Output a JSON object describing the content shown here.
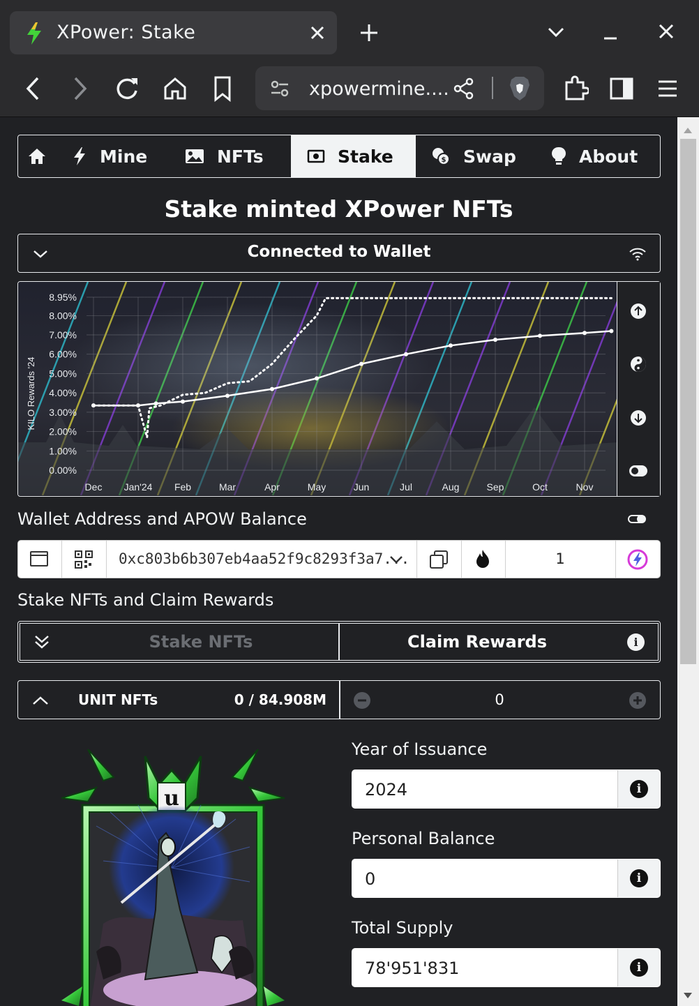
{
  "browser": {
    "tab_title": "XPower: Stake",
    "url": "xpowermine...."
  },
  "nav": {
    "items": [
      {
        "label": "Mine"
      },
      {
        "label": "NFTs"
      },
      {
        "label": "Stake"
      },
      {
        "label": "Swap"
      },
      {
        "label": "About"
      }
    ],
    "active": "Stake"
  },
  "page": {
    "title": "Stake minted XPower NFTs"
  },
  "wallet_bar": {
    "label": "Connected to Wallet"
  },
  "chart_data": {
    "type": "line",
    "ylabel": "KILO Rewards '24",
    "x_ticks": [
      "Dec",
      "Jan'24",
      "Feb",
      "Mar",
      "Apr",
      "May",
      "Jun",
      "Jul",
      "Aug",
      "Sep",
      "Oct",
      "Nov"
    ],
    "y_ticks": [
      "0.00%",
      "1.00%",
      "2.00%",
      "3.00%",
      "4.00%",
      "5.00%",
      "6.00%",
      "7.00%",
      "8.00%",
      "8.95%"
    ],
    "ylim": [
      0,
      8.95
    ],
    "grid": true,
    "series": [
      {
        "style": "solid",
        "color": "#ffffff",
        "points": [
          [
            0,
            3.35
          ],
          [
            1.0,
            3.35
          ],
          [
            1.4,
            3.45
          ],
          [
            2,
            3.55
          ],
          [
            3,
            3.85
          ],
          [
            4,
            4.2
          ],
          [
            5,
            4.75
          ],
          [
            6,
            5.5
          ],
          [
            7,
            6.0
          ],
          [
            8,
            6.45
          ],
          [
            9,
            6.75
          ],
          [
            10,
            6.95
          ],
          [
            11,
            7.1
          ],
          [
            11.6,
            7.2
          ]
        ]
      },
      {
        "style": "dotted",
        "color": "#ffffff",
        "points": [
          [
            0,
            3.35
          ],
          [
            1.0,
            3.35
          ],
          [
            1.2,
            1.7
          ],
          [
            1.25,
            3.2
          ],
          [
            1.5,
            3.35
          ],
          [
            2,
            3.9
          ],
          [
            2.5,
            4.0
          ],
          [
            3,
            4.5
          ],
          [
            3.5,
            4.6
          ],
          [
            4,
            5.5
          ],
          [
            4.5,
            6.8
          ],
          [
            5,
            8.0
          ],
          [
            5.2,
            8.9
          ],
          [
            5.4,
            8.9
          ],
          [
            6,
            8.9
          ],
          [
            7,
            8.9
          ],
          [
            8,
            8.9
          ],
          [
            9,
            8.9
          ],
          [
            10,
            8.9
          ],
          [
            11,
            8.9
          ],
          [
            11.6,
            8.9
          ]
        ]
      }
    ]
  },
  "wallet_section": {
    "label": "Wallet Address and APOW Balance",
    "address": "0xc803b6b307eb4aa52f9c8293f3a7...",
    "amount": "1"
  },
  "stake_section": {
    "label": "Stake NFTs and Claim Rewards",
    "stake_button": "Stake NFTs",
    "claim_button": "Claim Rewards"
  },
  "unit_nfts": {
    "label": "UNIT NFTs",
    "balance": "0 / 84.908M",
    "amount": "0"
  },
  "details": {
    "year_label": "Year of Issuance",
    "year_value": "2024",
    "balance_label": "Personal Balance",
    "balance_value": "0",
    "supply_label": "Total Supply",
    "supply_value": "78'951'831"
  },
  "nft_card": {
    "letter": "u"
  },
  "colors": {
    "accent_green": "#3bd23d",
    "chart_bg": "#1a1b22",
    "page_bg": "#202124"
  }
}
